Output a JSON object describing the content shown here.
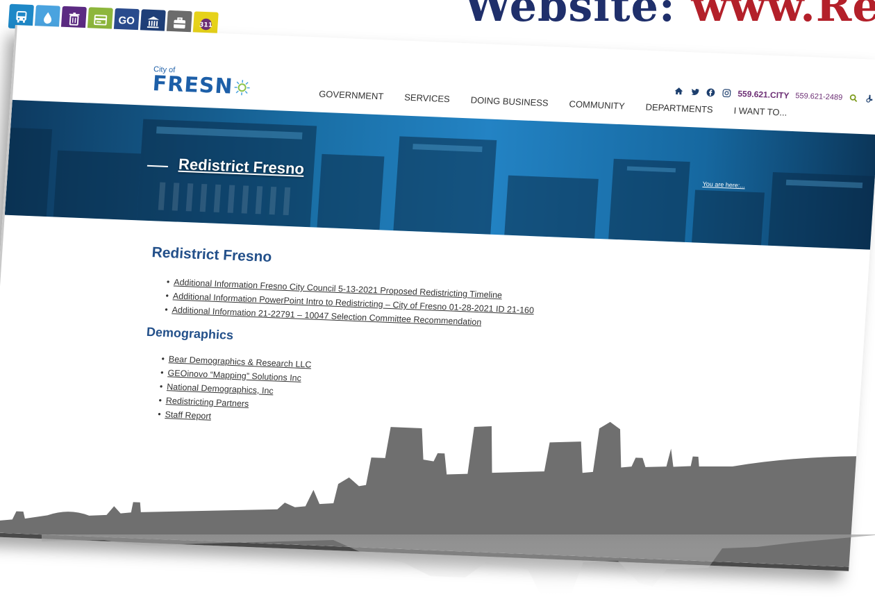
{
  "slide": {
    "heading_prefix": "Website: ",
    "heading_url": "www.Red"
  },
  "util_icons": [
    {
      "name": "bus-icon",
      "color": "#1e88c7"
    },
    {
      "name": "water-drop-icon",
      "color": "#4aa3df"
    },
    {
      "name": "trash-icon",
      "color": "#5b2a82"
    },
    {
      "name": "card-icon",
      "color": "#8db63c"
    },
    {
      "name": "go-icon",
      "color": "#2a4b8d",
      "label": "GO"
    },
    {
      "name": "government-building-icon",
      "color": "#1f3f78"
    },
    {
      "name": "briefcase-icon",
      "color": "#6b6b6b"
    },
    {
      "name": "311-icon",
      "color": "#e6d21a"
    }
  ],
  "header": {
    "logo_city": "City of",
    "logo_word": "FRESN",
    "nav": [
      "GOVERNMENT",
      "SERVICES",
      "DOING BUSINESS",
      "COMMUNITY",
      "DEPARTMENTS",
      "I WANT TO..."
    ],
    "main_phone": "559.621.CITY",
    "tty_phone": "559.621-2489"
  },
  "banner": {
    "title": "Redistrict Fresno",
    "breadcrumb": "You are here:..."
  },
  "content": {
    "heading": "Redistrict Fresno",
    "links": [
      "Additional Information Fresno City Council 5-13-2021 Proposed Redistricting Timeline",
      "Additional Information PowerPoint Intro to Redistricting – City of Fresno 01-28-2021 ID 21-160",
      "Additional Information 21-22791 – 10047 Selection Committee Recommendation"
    ],
    "demographics_heading": "Demographics",
    "demographics": [
      "Bear Demographics & Research LLC",
      "GEOinovo “Mapping” Solutions Inc",
      "National Demographics, Inc",
      "Redistricting Partners",
      "Staff Report"
    ]
  }
}
